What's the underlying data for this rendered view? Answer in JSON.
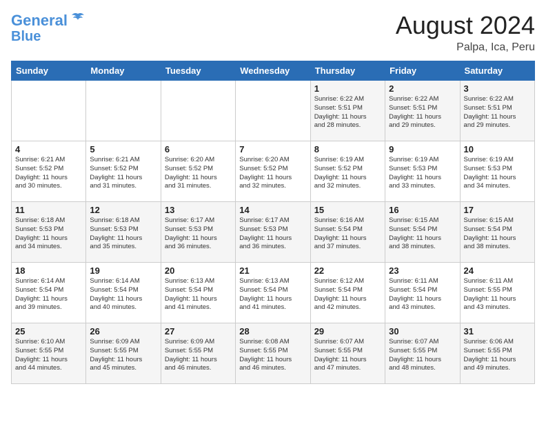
{
  "header": {
    "logo_line1": "General",
    "logo_line2": "Blue",
    "month_year": "August 2024",
    "location": "Palpa, Ica, Peru"
  },
  "weekdays": [
    "Sunday",
    "Monday",
    "Tuesday",
    "Wednesday",
    "Thursday",
    "Friday",
    "Saturday"
  ],
  "weeks": [
    [
      {
        "day": "",
        "info": ""
      },
      {
        "day": "",
        "info": ""
      },
      {
        "day": "",
        "info": ""
      },
      {
        "day": "",
        "info": ""
      },
      {
        "day": "1",
        "info": "Sunrise: 6:22 AM\nSunset: 5:51 PM\nDaylight: 11 hours\nand 28 minutes."
      },
      {
        "day": "2",
        "info": "Sunrise: 6:22 AM\nSunset: 5:51 PM\nDaylight: 11 hours\nand 29 minutes."
      },
      {
        "day": "3",
        "info": "Sunrise: 6:22 AM\nSunset: 5:51 PM\nDaylight: 11 hours\nand 29 minutes."
      }
    ],
    [
      {
        "day": "4",
        "info": "Sunrise: 6:21 AM\nSunset: 5:52 PM\nDaylight: 11 hours\nand 30 minutes."
      },
      {
        "day": "5",
        "info": "Sunrise: 6:21 AM\nSunset: 5:52 PM\nDaylight: 11 hours\nand 31 minutes."
      },
      {
        "day": "6",
        "info": "Sunrise: 6:20 AM\nSunset: 5:52 PM\nDaylight: 11 hours\nand 31 minutes."
      },
      {
        "day": "7",
        "info": "Sunrise: 6:20 AM\nSunset: 5:52 PM\nDaylight: 11 hours\nand 32 minutes."
      },
      {
        "day": "8",
        "info": "Sunrise: 6:19 AM\nSunset: 5:52 PM\nDaylight: 11 hours\nand 32 minutes."
      },
      {
        "day": "9",
        "info": "Sunrise: 6:19 AM\nSunset: 5:53 PM\nDaylight: 11 hours\nand 33 minutes."
      },
      {
        "day": "10",
        "info": "Sunrise: 6:19 AM\nSunset: 5:53 PM\nDaylight: 11 hours\nand 34 minutes."
      }
    ],
    [
      {
        "day": "11",
        "info": "Sunrise: 6:18 AM\nSunset: 5:53 PM\nDaylight: 11 hours\nand 34 minutes."
      },
      {
        "day": "12",
        "info": "Sunrise: 6:18 AM\nSunset: 5:53 PM\nDaylight: 11 hours\nand 35 minutes."
      },
      {
        "day": "13",
        "info": "Sunrise: 6:17 AM\nSunset: 5:53 PM\nDaylight: 11 hours\nand 36 minutes."
      },
      {
        "day": "14",
        "info": "Sunrise: 6:17 AM\nSunset: 5:53 PM\nDaylight: 11 hours\nand 36 minutes."
      },
      {
        "day": "15",
        "info": "Sunrise: 6:16 AM\nSunset: 5:54 PM\nDaylight: 11 hours\nand 37 minutes."
      },
      {
        "day": "16",
        "info": "Sunrise: 6:15 AM\nSunset: 5:54 PM\nDaylight: 11 hours\nand 38 minutes."
      },
      {
        "day": "17",
        "info": "Sunrise: 6:15 AM\nSunset: 5:54 PM\nDaylight: 11 hours\nand 38 minutes."
      }
    ],
    [
      {
        "day": "18",
        "info": "Sunrise: 6:14 AM\nSunset: 5:54 PM\nDaylight: 11 hours\nand 39 minutes."
      },
      {
        "day": "19",
        "info": "Sunrise: 6:14 AM\nSunset: 5:54 PM\nDaylight: 11 hours\nand 40 minutes."
      },
      {
        "day": "20",
        "info": "Sunrise: 6:13 AM\nSunset: 5:54 PM\nDaylight: 11 hours\nand 41 minutes."
      },
      {
        "day": "21",
        "info": "Sunrise: 6:13 AM\nSunset: 5:54 PM\nDaylight: 11 hours\nand 41 minutes."
      },
      {
        "day": "22",
        "info": "Sunrise: 6:12 AM\nSunset: 5:54 PM\nDaylight: 11 hours\nand 42 minutes."
      },
      {
        "day": "23",
        "info": "Sunrise: 6:11 AM\nSunset: 5:54 PM\nDaylight: 11 hours\nand 43 minutes."
      },
      {
        "day": "24",
        "info": "Sunrise: 6:11 AM\nSunset: 5:55 PM\nDaylight: 11 hours\nand 43 minutes."
      }
    ],
    [
      {
        "day": "25",
        "info": "Sunrise: 6:10 AM\nSunset: 5:55 PM\nDaylight: 11 hours\nand 44 minutes."
      },
      {
        "day": "26",
        "info": "Sunrise: 6:09 AM\nSunset: 5:55 PM\nDaylight: 11 hours\nand 45 minutes."
      },
      {
        "day": "27",
        "info": "Sunrise: 6:09 AM\nSunset: 5:55 PM\nDaylight: 11 hours\nand 46 minutes."
      },
      {
        "day": "28",
        "info": "Sunrise: 6:08 AM\nSunset: 5:55 PM\nDaylight: 11 hours\nand 46 minutes."
      },
      {
        "day": "29",
        "info": "Sunrise: 6:07 AM\nSunset: 5:55 PM\nDaylight: 11 hours\nand 47 minutes."
      },
      {
        "day": "30",
        "info": "Sunrise: 6:07 AM\nSunset: 5:55 PM\nDaylight: 11 hours\nand 48 minutes."
      },
      {
        "day": "31",
        "info": "Sunrise: 6:06 AM\nSunset: 5:55 PM\nDaylight: 11 hours\nand 49 minutes."
      }
    ]
  ]
}
